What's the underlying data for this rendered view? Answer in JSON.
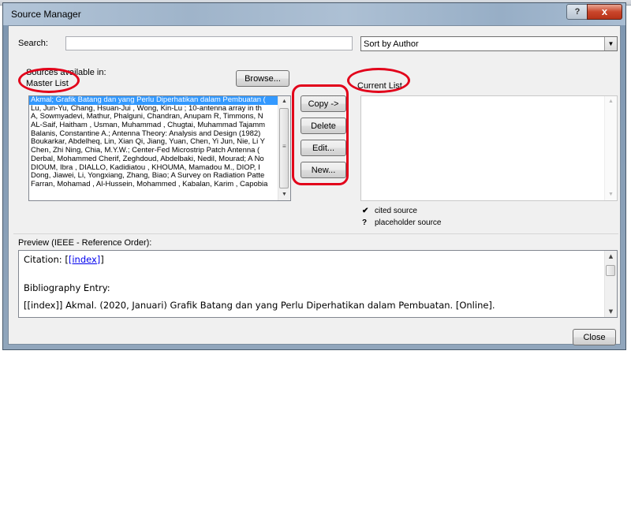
{
  "window": {
    "title": "Source Manager",
    "help_glyph": "?",
    "close_glyph": "x"
  },
  "search": {
    "label": "Search:",
    "value": "",
    "placeholder": ""
  },
  "sort": {
    "selected": "Sort by Author"
  },
  "sources_available_label": "Sources available in:",
  "master_list": {
    "label": "Master List",
    "browse_label": "Browse...",
    "items": [
      "Akmal; Grafik Batang dan yang Perlu Diperhatikan dalam Pembuatan (",
      "Lu, Jun-Yu, Chang, Hsuan-Jui , Wong, Kin-Lu ; 10-antenna array in th",
      "A, Sowmyadevi, Mathur, Phalguni, Chandran, Anupam R, Timmons, N",
      "AL-Saif, Haitham , Usman, Muhammad , Chugtai, Muhammad Tajamm",
      "Balanis, Constantine A.; Antenna Theory: Analysis and Design (1982)",
      "Boukarkar, Abdelheq, Lin, Xian Qi, Jiang, Yuan, Chen, Yi Jun, Nie, Li Y",
      "Chen, Zhi Ning, Chia, M.Y.W.; Center-Fed Microstrip Patch Antenna (",
      "Derbal, Mohammed Cherif, Zeghdoud, Abdelbaki, Nedil, Mourad; A No",
      "DIOUM, Ibra , DIALLO, Kadidiatou , KHOUMA, Mamadou M., DIOP, I",
      "Dong, Jiawei, Li, Yongxiang, Zhang, Biao; A Survey on Radiation Patte",
      "Farran, Mohamad , Al-Hussein, Mohammed , Kabalan, Karim , Capobia"
    ]
  },
  "actions": {
    "copy": "Copy ->",
    "delete": "Delete",
    "edit": "Edit...",
    "new": "New..."
  },
  "current_list": {
    "label": "Current List",
    "items": []
  },
  "legend": [
    {
      "symbol": "✔",
      "text": "cited source"
    },
    {
      "symbol": "?",
      "text": "placeholder source"
    }
  ],
  "preview": {
    "label": "Preview (IEEE - Reference Order):",
    "citation_prefix": "Citation:",
    "citation_open": "[",
    "citation_link": "[index]",
    "citation_close": "]",
    "bibliography_heading": "Bibliography Entry:",
    "bibliography_text": "[[index]] Akmal. (2020, Januari) Grafik Batang dan yang Perlu Diperhatikan dalam Pembuatan. [Online]."
  },
  "close_button": "Close",
  "annotation_color": "#e2001a"
}
